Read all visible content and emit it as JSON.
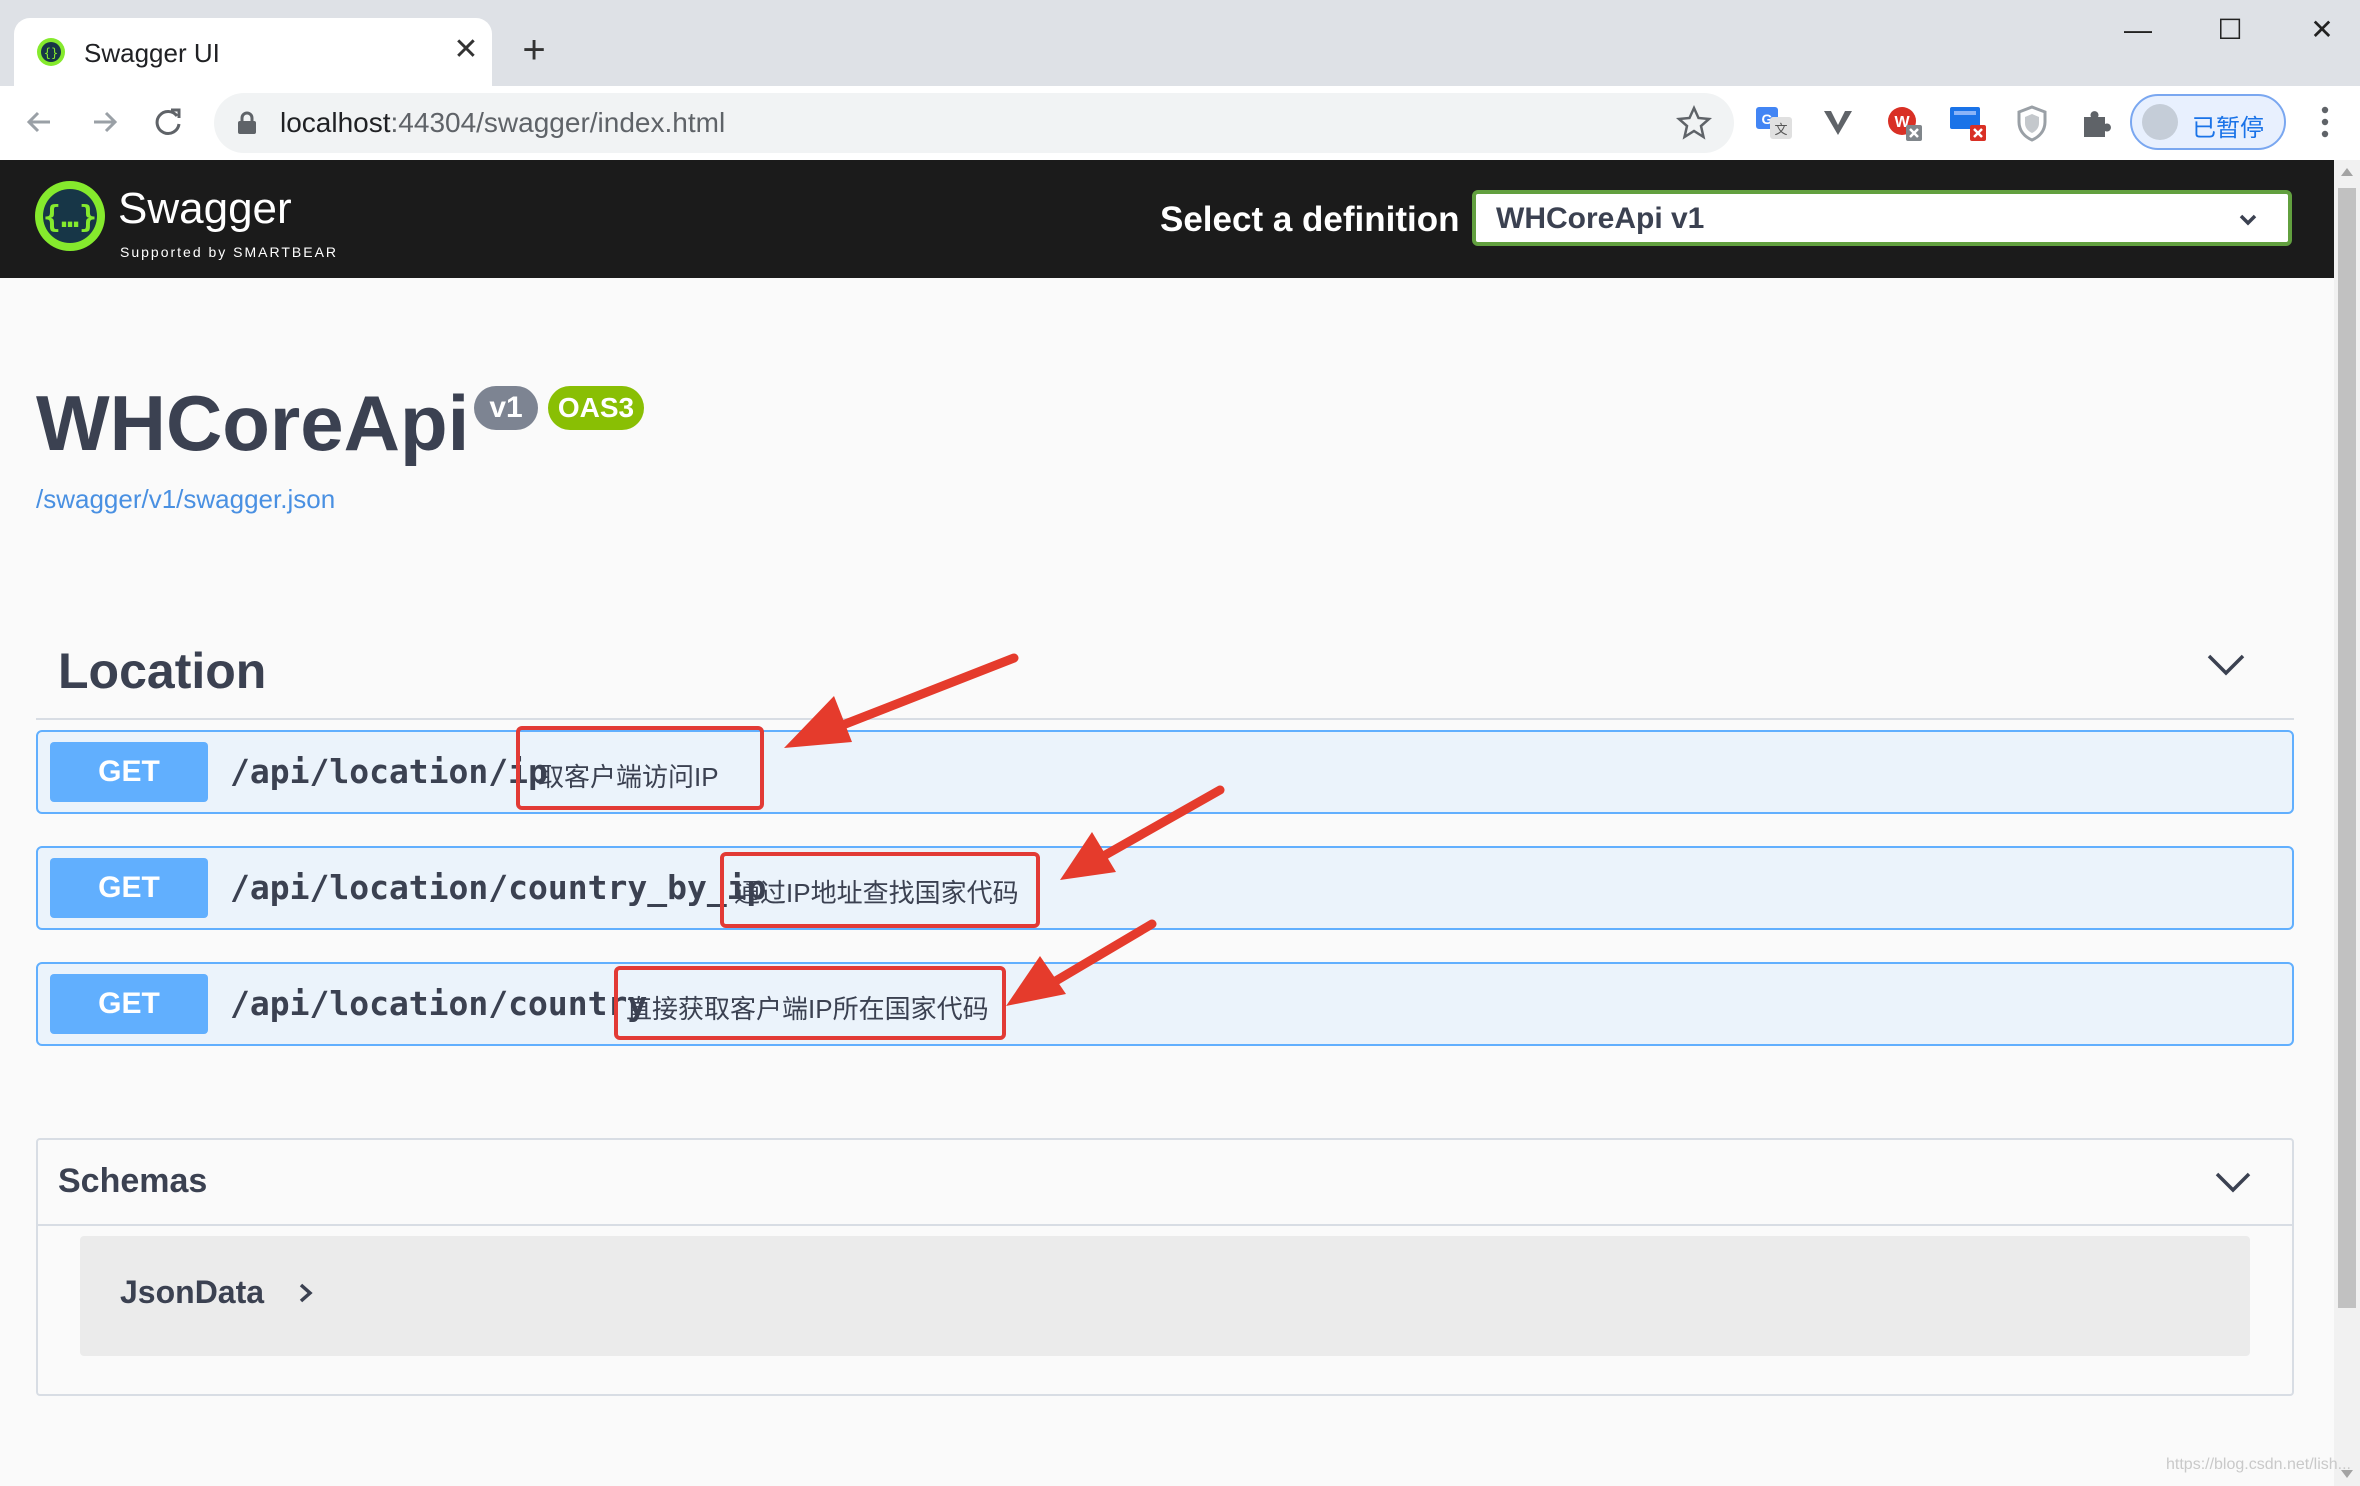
{
  "browser": {
    "tab_title": "Swagger UI",
    "tab_close": "✕",
    "new_tab": "+",
    "window_controls": {
      "minimize": "—",
      "maximize": "☐",
      "close": "✕"
    },
    "url_host": "localhost",
    "url_path": ":44304/swagger/index.html",
    "profile_label": "已暂停",
    "icons": [
      "back-icon",
      "forward-icon",
      "reload-icon",
      "lock-icon",
      "star-icon",
      "translate-icon",
      "v-extension-icon",
      "adblock-icon",
      "screen-extension-icon",
      "shield-icon",
      "puzzle-icon",
      "avatar",
      "menu-icon"
    ]
  },
  "topbar": {
    "logo_word": "Swagger",
    "logo_sub": "Supported by SMARTBEAR",
    "definition_label": "Select a definition",
    "definition_value": "WHCoreApi v1"
  },
  "info": {
    "title": "WHCoreApi",
    "version_badge": "v1",
    "oas_badge": "OAS3",
    "spec_link": "/swagger/v1/swagger.json"
  },
  "tag": {
    "name": "Location",
    "operations": [
      {
        "method": "GET",
        "path": "/api/location/ip",
        "summary": "取客户端访问IP"
      },
      {
        "method": "GET",
        "path": "/api/location/country_by_ip",
        "summary": "通过IP地址查找国家代码"
      },
      {
        "method": "GET",
        "path": "/api/location/country",
        "summary": "直接获取客户端IP所在国家代码"
      }
    ]
  },
  "schemas": {
    "title": "Schemas",
    "models": [
      "JsonData"
    ]
  },
  "colors": {
    "get": "#61affe",
    "get_bg": "#ebf3fb",
    "topbar": "#1b1b1b",
    "oas_badge": "#89bf04",
    "version_badge": "#7d8492",
    "annotation": "#e23a35"
  },
  "watermark": "https://blog.csdn.net/lish..."
}
